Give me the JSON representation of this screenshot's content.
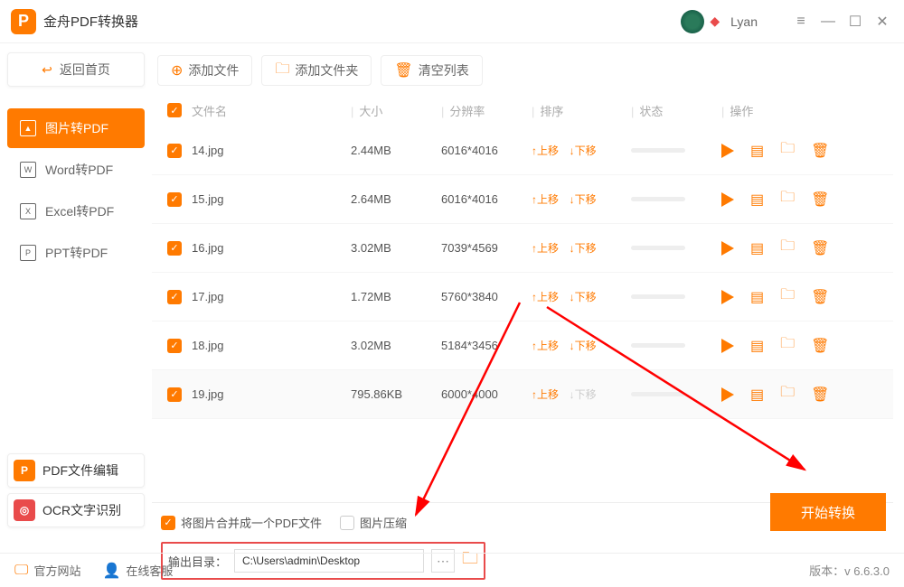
{
  "app": {
    "title": "金舟PDF转换器",
    "username": "Lyan"
  },
  "sidebar": {
    "back": "返回首页",
    "items": [
      {
        "label": "图片转PDF"
      },
      {
        "label": "Word转PDF"
      },
      {
        "label": "Excel转PDF"
      },
      {
        "label": "PPT转PDF"
      }
    ],
    "tools": [
      {
        "label": "PDF文件编辑",
        "icon": "P",
        "bg": "#ff7a00"
      },
      {
        "label": "OCR文字识别",
        "icon": "◎",
        "bg": "#e94b4b"
      }
    ]
  },
  "toolbar": {
    "add_file": "添加文件",
    "add_folder": "添加文件夹",
    "clear": "清空列表"
  },
  "headers": {
    "name": "文件名",
    "size": "大小",
    "res": "分辨率",
    "order": "排序",
    "status": "状态",
    "op": "操作"
  },
  "order_labels": {
    "up": "上移",
    "down": "下移"
  },
  "files": [
    {
      "name": "14.jpg",
      "size": "2.44MB",
      "res": "6016*4016"
    },
    {
      "name": "15.jpg",
      "size": "2.64MB",
      "res": "6016*4016"
    },
    {
      "name": "16.jpg",
      "size": "3.02MB",
      "res": "7039*4569"
    },
    {
      "name": "17.jpg",
      "size": "1.72MB",
      "res": "5760*3840"
    },
    {
      "name": "18.jpg",
      "size": "3.02MB",
      "res": "5184*3456"
    },
    {
      "name": "19.jpg",
      "size": "795.86KB",
      "res": "6000*4000"
    }
  ],
  "options": {
    "merge": "将图片合并成一个PDF文件",
    "compress": "图片压缩",
    "output_label": "输出目录：",
    "output_path": "C:\\Users\\admin\\Desktop"
  },
  "buttons": {
    "start": "开始转换"
  },
  "statusbar": {
    "site": "官方网站",
    "support": "在线客服",
    "version_label": "版本：",
    "version": "v 6.6.3.0"
  }
}
